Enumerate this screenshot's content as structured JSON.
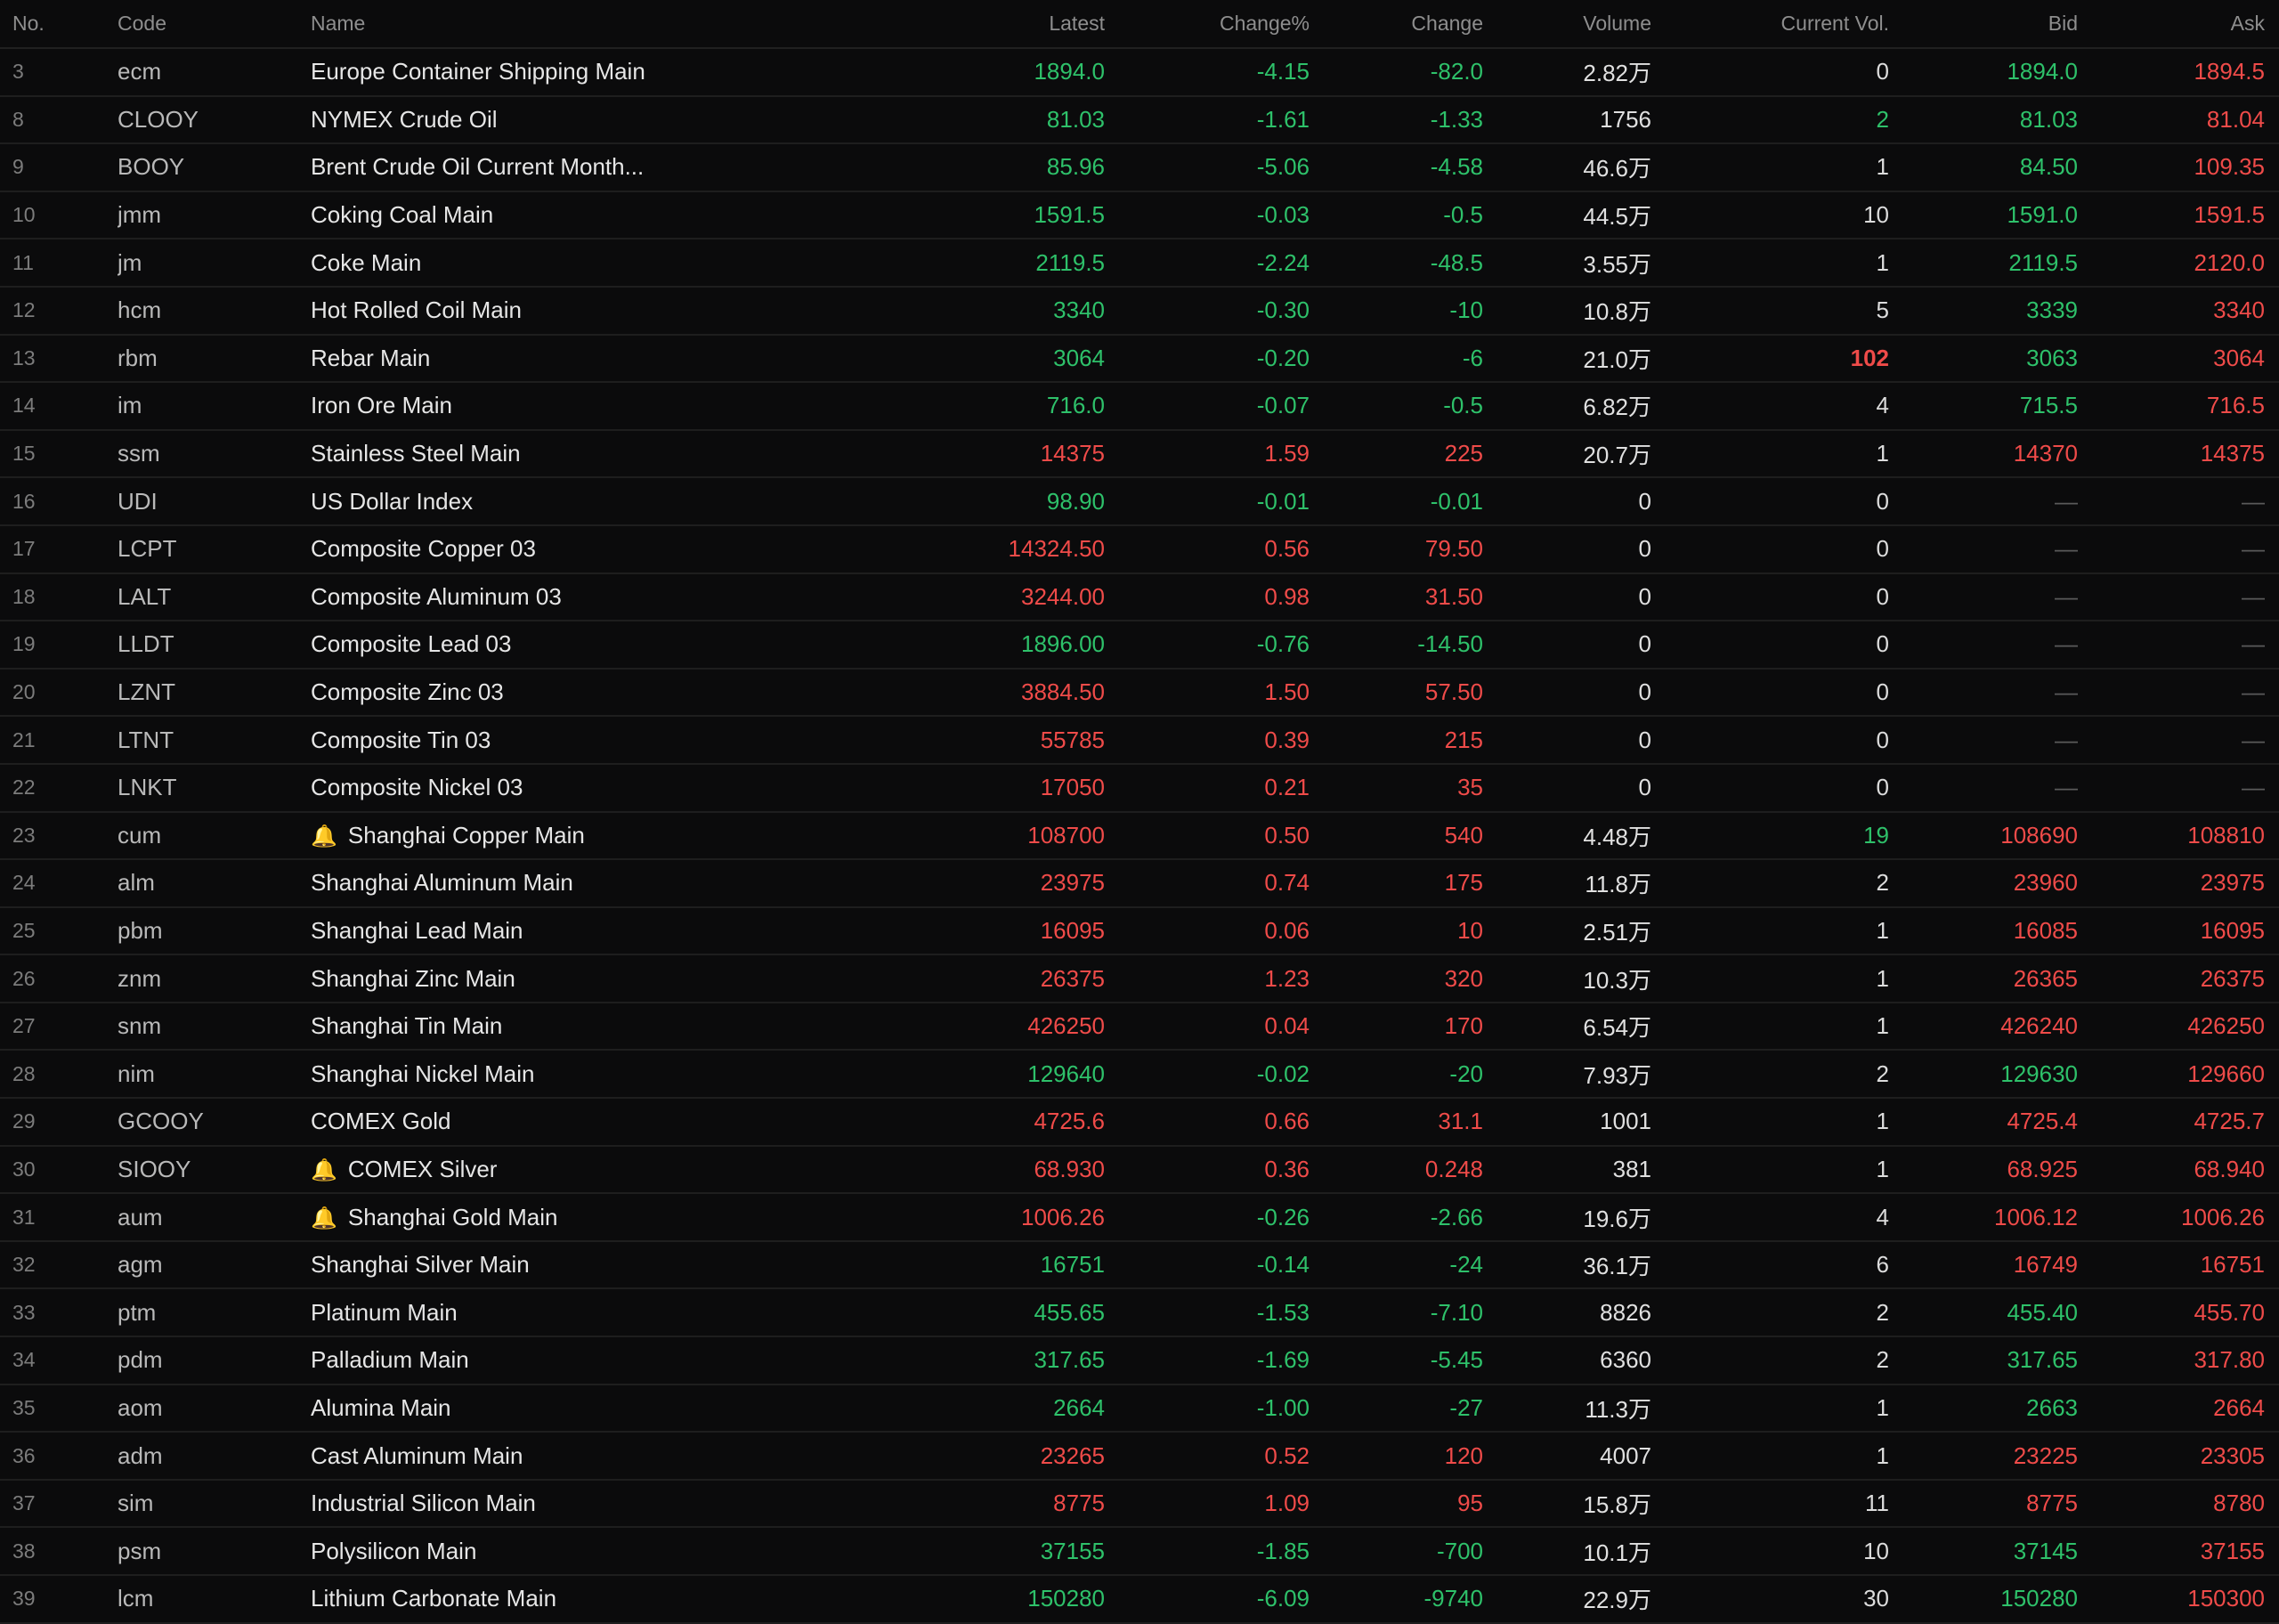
{
  "colors": {
    "up": "#ef4b49",
    "down": "#2ec16a",
    "neutral": "#dcdcdc",
    "background": "#0b0b0c"
  },
  "columns": {
    "no": "No.",
    "code": "Code",
    "name": "Name",
    "latest": "Latest",
    "change_pct": "Change%",
    "change": "Change",
    "volume": "Volume",
    "current_vol": "Current Vol.",
    "bid": "Bid",
    "ask": "Ask"
  },
  "rows": [
    {
      "no": "3",
      "code": "ecm",
      "name": "Europe Container Shipping Main",
      "latest": "1894.0",
      "pct": "-4.15",
      "chg": "-82.0",
      "vol": "2.82万",
      "cur": "0",
      "bid": "1894.0",
      "ask": "1894.5",
      "dir": "down",
      "cur_style": "flat",
      "bid_style": "down",
      "ask_style": "up",
      "bell": false
    },
    {
      "no": "8",
      "code": "CLOOY",
      "name": "NYMEX Crude Oil",
      "latest": "81.03",
      "pct": "-1.61",
      "chg": "-1.33",
      "vol": "1756",
      "cur": "2",
      "bid": "81.03",
      "ask": "81.04",
      "dir": "down",
      "cur_style": "down",
      "bid_style": "down",
      "ask_style": "up",
      "bell": false
    },
    {
      "no": "9",
      "code": "BOOY",
      "name": "Brent Crude Oil Current Month...",
      "latest": "85.96",
      "pct": "-5.06",
      "chg": "-4.58",
      "vol": "46.6万",
      "cur": "1",
      "bid": "84.50",
      "ask": "109.35",
      "dir": "down",
      "cur_style": "flat",
      "bid_style": "down",
      "ask_style": "up",
      "bell": false
    },
    {
      "no": "10",
      "code": "jmm",
      "name": "Coking Coal Main",
      "latest": "1591.5",
      "pct": "-0.03",
      "chg": "-0.5",
      "vol": "44.5万",
      "cur": "10",
      "bid": "1591.0",
      "ask": "1591.5",
      "dir": "down",
      "cur_style": "flat",
      "bid_style": "down",
      "ask_style": "up",
      "bell": false
    },
    {
      "no": "11",
      "code": "jm",
      "name": "Coke Main",
      "latest": "2119.5",
      "pct": "-2.24",
      "chg": "-48.5",
      "vol": "3.55万",
      "cur": "1",
      "bid": "2119.5",
      "ask": "2120.0",
      "dir": "down",
      "cur_style": "flat",
      "bid_style": "down",
      "ask_style": "up",
      "bell": false
    },
    {
      "no": "12",
      "code": "hcm",
      "name": "Hot Rolled Coil Main",
      "latest": "3340",
      "pct": "-0.30",
      "chg": "-10",
      "vol": "10.8万",
      "cur": "5",
      "bid": "3339",
      "ask": "3340",
      "dir": "down",
      "cur_style": "flat",
      "bid_style": "down",
      "ask_style": "up",
      "bell": false
    },
    {
      "no": "13",
      "code": "rbm",
      "name": "Rebar Main",
      "latest": "3064",
      "pct": "-0.20",
      "chg": "-6",
      "vol": "21.0万",
      "cur": "102",
      "bid": "3063",
      "ask": "3064",
      "dir": "down",
      "cur_style": "hi",
      "bid_style": "down",
      "ask_style": "up",
      "bell": false
    },
    {
      "no": "14",
      "code": "im",
      "name": "Iron Ore Main",
      "latest": "716.0",
      "pct": "-0.07",
      "chg": "-0.5",
      "vol": "6.82万",
      "cur": "4",
      "bid": "715.5",
      "ask": "716.5",
      "dir": "down",
      "cur_style": "flat",
      "bid_style": "down",
      "ask_style": "up",
      "bell": false
    },
    {
      "no": "15",
      "code": "ssm",
      "name": "Stainless Steel Main",
      "latest": "14375",
      "pct": "1.59",
      "chg": "225",
      "vol": "20.7万",
      "cur": "1",
      "bid": "14370",
      "ask": "14375",
      "dir": "up",
      "cur_style": "flat",
      "bid_style": "up",
      "ask_style": "up",
      "bell": false
    },
    {
      "no": "16",
      "code": "UDI",
      "name": "US Dollar Index",
      "latest": "98.90",
      "pct": "-0.01",
      "chg": "-0.01",
      "vol": "0",
      "cur": "0",
      "bid": "—",
      "ask": "—",
      "dir": "down",
      "cur_style": "flat",
      "bid_style": "dash",
      "ask_style": "dash",
      "bell": false
    },
    {
      "no": "17",
      "code": "LCPT",
      "name": "Composite Copper 03",
      "latest": "14324.50",
      "pct": "0.56",
      "chg": "79.50",
      "vol": "0",
      "cur": "0",
      "bid": "—",
      "ask": "—",
      "dir": "up",
      "cur_style": "flat",
      "bid_style": "dash",
      "ask_style": "dash",
      "bell": false
    },
    {
      "no": "18",
      "code": "LALT",
      "name": "Composite Aluminum 03",
      "latest": "3244.00",
      "pct": "0.98",
      "chg": "31.50",
      "vol": "0",
      "cur": "0",
      "bid": "—",
      "ask": "—",
      "dir": "up",
      "cur_style": "flat",
      "bid_style": "dash",
      "ask_style": "dash",
      "bell": false
    },
    {
      "no": "19",
      "code": "LLDT",
      "name": "Composite Lead 03",
      "latest": "1896.00",
      "pct": "-0.76",
      "chg": "-14.50",
      "vol": "0",
      "cur": "0",
      "bid": "—",
      "ask": "—",
      "dir": "down",
      "cur_style": "flat",
      "bid_style": "dash",
      "ask_style": "dash",
      "bell": false
    },
    {
      "no": "20",
      "code": "LZNT",
      "name": "Composite Zinc 03",
      "latest": "3884.50",
      "pct": "1.50",
      "chg": "57.50",
      "vol": "0",
      "cur": "0",
      "bid": "—",
      "ask": "—",
      "dir": "up",
      "cur_style": "flat",
      "bid_style": "dash",
      "ask_style": "dash",
      "bell": false
    },
    {
      "no": "21",
      "code": "LTNT",
      "name": "Composite Tin 03",
      "latest": "55785",
      "pct": "0.39",
      "chg": "215",
      "vol": "0",
      "cur": "0",
      "bid": "—",
      "ask": "—",
      "dir": "up",
      "cur_style": "flat",
      "bid_style": "dash",
      "ask_style": "dash",
      "bell": false
    },
    {
      "no": "22",
      "code": "LNKT",
      "name": "Composite Nickel 03",
      "latest": "17050",
      "pct": "0.21",
      "chg": "35",
      "vol": "0",
      "cur": "0",
      "bid": "—",
      "ask": "—",
      "dir": "up",
      "cur_style": "flat",
      "bid_style": "dash",
      "ask_style": "dash",
      "bell": false
    },
    {
      "no": "23",
      "code": "cum",
      "name": "Shanghai Copper Main",
      "latest": "108700",
      "pct": "0.50",
      "chg": "540",
      "vol": "4.48万",
      "cur": "19",
      "bid": "108690",
      "ask": "108810",
      "dir": "up",
      "cur_style": "down",
      "bid_style": "up",
      "ask_style": "up",
      "bell": true
    },
    {
      "no": "24",
      "code": "alm",
      "name": "Shanghai Aluminum Main",
      "latest": "23975",
      "pct": "0.74",
      "chg": "175",
      "vol": "11.8万",
      "cur": "2",
      "bid": "23960",
      "ask": "23975",
      "dir": "up",
      "cur_style": "flat",
      "bid_style": "up",
      "ask_style": "up",
      "bell": false
    },
    {
      "no": "25",
      "code": "pbm",
      "name": "Shanghai Lead Main",
      "latest": "16095",
      "pct": "0.06",
      "chg": "10",
      "vol": "2.51万",
      "cur": "1",
      "bid": "16085",
      "ask": "16095",
      "dir": "up",
      "cur_style": "flat",
      "bid_style": "up",
      "ask_style": "up",
      "bell": false
    },
    {
      "no": "26",
      "code": "znm",
      "name": "Shanghai Zinc Main",
      "latest": "26375",
      "pct": "1.23",
      "chg": "320",
      "vol": "10.3万",
      "cur": "1",
      "bid": "26365",
      "ask": "26375",
      "dir": "up",
      "cur_style": "flat",
      "bid_style": "up",
      "ask_style": "up",
      "bell": false
    },
    {
      "no": "27",
      "code": "snm",
      "name": "Shanghai Tin Main",
      "latest": "426250",
      "pct": "0.04",
      "chg": "170",
      "vol": "6.54万",
      "cur": "1",
      "bid": "426240",
      "ask": "426250",
      "dir": "up",
      "cur_style": "flat",
      "bid_style": "up",
      "ask_style": "up",
      "bell": false
    },
    {
      "no": "28",
      "code": "nim",
      "name": "Shanghai Nickel Main",
      "latest": "129640",
      "pct": "-0.02",
      "chg": "-20",
      "vol": "7.93万",
      "cur": "2",
      "bid": "129630",
      "ask": "129660",
      "dir": "down",
      "cur_style": "flat",
      "bid_style": "down",
      "ask_style": "up",
      "bell": false
    },
    {
      "no": "29",
      "code": "GCOOY",
      "name": "COMEX Gold",
      "latest": "4725.6",
      "pct": "0.66",
      "chg": "31.1",
      "vol": "1001",
      "cur": "1",
      "bid": "4725.4",
      "ask": "4725.7",
      "dir": "up",
      "cur_style": "flat",
      "bid_style": "up",
      "ask_style": "up",
      "bell": false
    },
    {
      "no": "30",
      "code": "SIOOY",
      "name": "COMEX Silver",
      "latest": "68.930",
      "pct": "0.36",
      "chg": "0.248",
      "vol": "381",
      "cur": "1",
      "bid": "68.925",
      "ask": "68.940",
      "dir": "up",
      "cur_style": "flat",
      "bid_style": "up",
      "ask_style": "up",
      "bell": true
    },
    {
      "no": "31",
      "code": "aum",
      "name": "Shanghai Gold Main",
      "latest": "1006.26",
      "pct": "-0.26",
      "chg": "-2.66",
      "vol": "19.6万",
      "cur": "4",
      "bid": "1006.12",
      "ask": "1006.26",
      "dir": "up",
      "pct_style": "down",
      "chg_style": "down",
      "cur_style": "flat",
      "bid_style": "up",
      "ask_style": "up",
      "bell": true
    },
    {
      "no": "32",
      "code": "agm",
      "name": "Shanghai Silver Main",
      "latest": "16751",
      "pct": "-0.14",
      "chg": "-24",
      "vol": "36.1万",
      "cur": "6",
      "bid": "16749",
      "ask": "16751",
      "dir": "down",
      "cur_style": "flat",
      "bid_style": "up",
      "ask_style": "up",
      "bell": false
    },
    {
      "no": "33",
      "code": "ptm",
      "name": "Platinum Main",
      "latest": "455.65",
      "pct": "-1.53",
      "chg": "-7.10",
      "vol": "8826",
      "cur": "2",
      "bid": "455.40",
      "ask": "455.70",
      "dir": "down",
      "cur_style": "flat",
      "bid_style": "down",
      "ask_style": "up",
      "bell": false
    },
    {
      "no": "34",
      "code": "pdm",
      "name": "Palladium Main",
      "latest": "317.65",
      "pct": "-1.69",
      "chg": "-5.45",
      "vol": "6360",
      "cur": "2",
      "bid": "317.65",
      "ask": "317.80",
      "dir": "down",
      "cur_style": "flat",
      "bid_style": "down",
      "ask_style": "up",
      "bell": false
    },
    {
      "no": "35",
      "code": "aom",
      "name": "Alumina Main",
      "latest": "2664",
      "pct": "-1.00",
      "chg": "-27",
      "vol": "11.3万",
      "cur": "1",
      "bid": "2663",
      "ask": "2664",
      "dir": "down",
      "cur_style": "flat",
      "bid_style": "down",
      "ask_style": "up",
      "bell": false
    },
    {
      "no": "36",
      "code": "adm",
      "name": "Cast Aluminum Main",
      "latest": "23265",
      "pct": "0.52",
      "chg": "120",
      "vol": "4007",
      "cur": "1",
      "bid": "23225",
      "ask": "23305",
      "dir": "up",
      "cur_style": "flat",
      "bid_style": "up",
      "ask_style": "up",
      "bell": false
    },
    {
      "no": "37",
      "code": "sim",
      "name": "Industrial Silicon Main",
      "latest": "8775",
      "pct": "1.09",
      "chg": "95",
      "vol": "15.8万",
      "cur": "11",
      "bid": "8775",
      "ask": "8780",
      "dir": "up",
      "cur_style": "flat",
      "bid_style": "up",
      "ask_style": "up",
      "bell": false
    },
    {
      "no": "38",
      "code": "psm",
      "name": "Polysilicon Main",
      "latest": "37155",
      "pct": "-1.85",
      "chg": "-700",
      "vol": "10.1万",
      "cur": "10",
      "bid": "37145",
      "ask": "37155",
      "dir": "down",
      "cur_style": "flat",
      "bid_style": "down",
      "ask_style": "up",
      "bell": false
    },
    {
      "no": "39",
      "code": "lcm",
      "name": "Lithium Carbonate Main",
      "latest": "150280",
      "pct": "-6.09",
      "chg": "-9740",
      "vol": "22.9万",
      "cur": "30",
      "bid": "150280",
      "ask": "150300",
      "dir": "down",
      "cur_style": "flat",
      "bid_style": "down",
      "ask_style": "up",
      "bell": false
    }
  ]
}
